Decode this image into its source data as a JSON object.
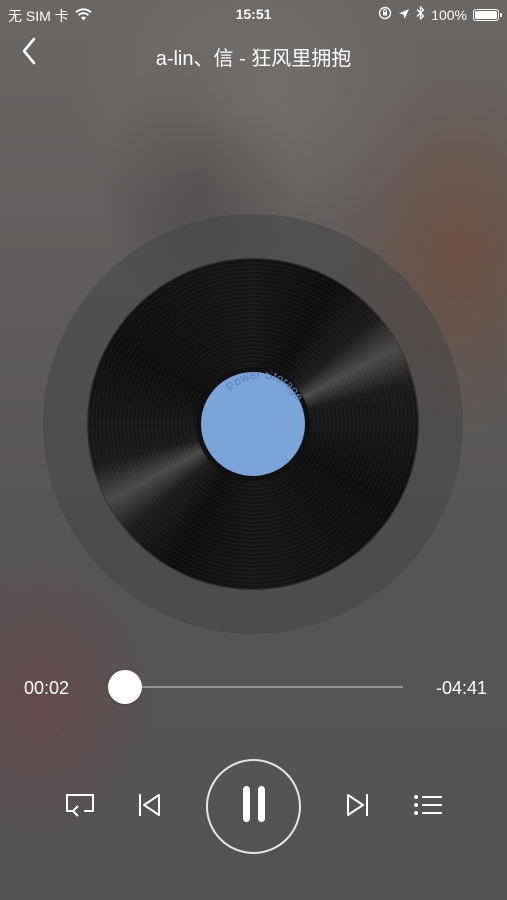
{
  "status_bar": {
    "carrier": "无 SIM 卡",
    "time": "15:51",
    "battery": "100%",
    "icons": [
      "wifi-icon",
      "lock-rotation-icon",
      "location-icon",
      "bluetooth-icon",
      "battery-icon"
    ]
  },
  "header": {
    "title": "a-lin、信 - 狂风里拥抱",
    "back_icon": "chevron-left-icon"
  },
  "disc": {
    "label_text": "Power Storage",
    "label_color": "#7ba4d9"
  },
  "progress": {
    "elapsed": "00:02",
    "remaining": "-04:41",
    "fraction": 0.007
  },
  "controls": {
    "repeat_icon": "repeat-icon",
    "previous_icon": "skip-previous-icon",
    "play_pause_icon": "pause-icon",
    "next_icon": "skip-next-icon",
    "playlist_icon": "playlist-icon"
  }
}
